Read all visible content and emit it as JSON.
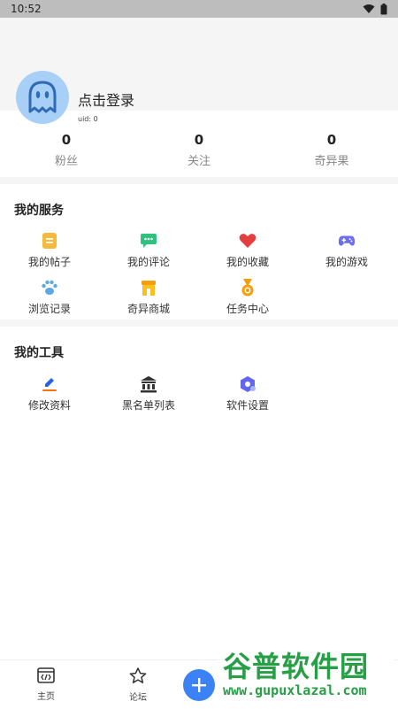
{
  "status_bar": {
    "time": "10:52",
    "icons": [
      "wifi-icon",
      "battery-icon"
    ]
  },
  "profile": {
    "login_prompt": "点击登录",
    "uid": "uid: 0"
  },
  "stats": [
    {
      "value": "0",
      "label": "粉丝"
    },
    {
      "value": "0",
      "label": "关注"
    },
    {
      "value": "0",
      "label": "奇异果"
    }
  ],
  "services": {
    "title": "我的服务",
    "items": [
      {
        "label": "我的帖子",
        "icon": "post-icon"
      },
      {
        "label": "我的评论",
        "icon": "comment-icon"
      },
      {
        "label": "我的收藏",
        "icon": "heart-icon"
      },
      {
        "label": "我的游戏",
        "icon": "gamepad-icon"
      },
      {
        "label": "浏览记录",
        "icon": "paw-icon"
      },
      {
        "label": "奇异商城",
        "icon": "shop-icon"
      },
      {
        "label": "任务中心",
        "icon": "medal-icon"
      }
    ]
  },
  "tools": {
    "title": "我的工具",
    "items": [
      {
        "label": "修改资料",
        "icon": "pen-icon"
      },
      {
        "label": "黑名单列表",
        "icon": "blacklist-icon"
      },
      {
        "label": "软件设置",
        "icon": "settings-icon"
      }
    ]
  },
  "bottom_nav": [
    {
      "label": "主页",
      "icon": "code-icon"
    },
    {
      "label": "论坛",
      "icon": "star-icon"
    }
  ],
  "fab": {
    "icon": "plus-icon"
  },
  "watermark": {
    "line1": "谷普软件园",
    "line2": "www.gupuxlazal.com"
  },
  "colors": {
    "accent": "#3b82f6",
    "avatar_bg": "#a8cff5",
    "watermark": "#1b9a3c"
  }
}
